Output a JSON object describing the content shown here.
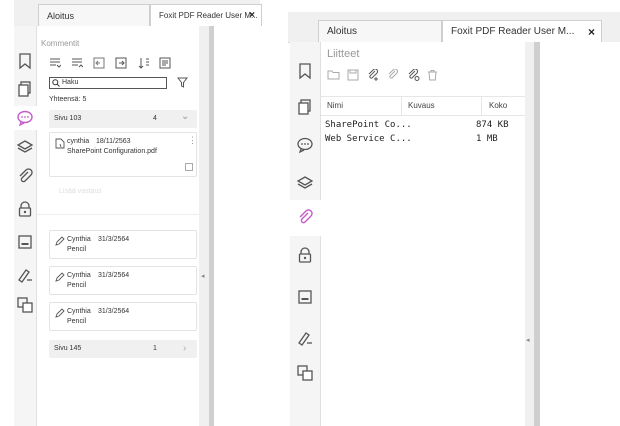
{
  "left": {
    "tabs": [
      {
        "label": "Aloitus"
      },
      {
        "label": "Foxit PDF Reader User M...",
        "close": "×"
      }
    ],
    "panel_title": "Kommentit",
    "search_placeholder": "Haku",
    "total": "Yhteensä: 5",
    "groups": [
      {
        "label": "Sivu 103",
        "count": "4",
        "chevron": "⌄"
      },
      {
        "label": "Sivu 145",
        "count": "1",
        "chevron": "›"
      }
    ],
    "attachment_comment": {
      "author": "cynthia",
      "date": "18/11/2563",
      "file": "SharePoint Configuration.pdf"
    },
    "reply_placeholder": "Lisää vastaus",
    "pencil_comments": [
      {
        "author": "Cynthia",
        "date": "31/3/2564",
        "type": "Pencil"
      },
      {
        "author": "Cynthia",
        "date": "31/3/2564",
        "type": "Pencil"
      },
      {
        "author": "Cynthia",
        "date": "31/3/2564",
        "type": "Pencil"
      }
    ],
    "collapse_arrow": "◂"
  },
  "right": {
    "tabs": [
      {
        "label": "Aloitus"
      },
      {
        "label": "Foxit PDF Reader User M...",
        "close": "×"
      }
    ],
    "panel_title": "Liitteet",
    "columns": [
      "Nimi",
      "Kuvaus",
      "Koko"
    ],
    "rows": [
      {
        "name": "SharePoint Co...",
        "desc": "",
        "size": "874 KB"
      },
      {
        "name": "Web Service C...",
        "desc": "",
        "size": "1 MB"
      }
    ],
    "collapse_arrow": "◂"
  },
  "colors": {
    "accent": "#c45bc9",
    "sidebar": "#f5f5f5",
    "divider": "#cfcfcf"
  }
}
